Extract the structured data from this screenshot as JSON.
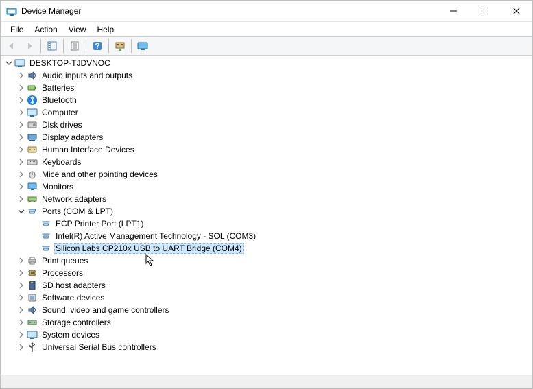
{
  "window": {
    "title": "Device Manager"
  },
  "menu": {
    "items": [
      "File",
      "Action",
      "View",
      "Help"
    ]
  },
  "tree": {
    "root": "DESKTOP-TJDVNOC",
    "nodes": {
      "audio": {
        "label": "Audio inputs and outputs"
      },
      "batt": {
        "label": "Batteries"
      },
      "bt": {
        "label": "Bluetooth"
      },
      "comp": {
        "label": "Computer"
      },
      "disk": {
        "label": "Disk drives"
      },
      "disp": {
        "label": "Display adapters"
      },
      "hid": {
        "label": "Human Interface Devices"
      },
      "kbd": {
        "label": "Keyboards"
      },
      "mouse": {
        "label": "Mice and other pointing devices"
      },
      "mon": {
        "label": "Monitors"
      },
      "net": {
        "label": "Network adapters"
      },
      "ports": {
        "label": "Ports (COM & LPT)"
      },
      "ports_c0": {
        "label": "ECP Printer Port (LPT1)"
      },
      "ports_c1": {
        "label": "Intel(R) Active Management Technology - SOL (COM3)"
      },
      "ports_c2": {
        "label": "Silicon Labs CP210x USB to UART Bridge (COM4)"
      },
      "printq": {
        "label": "Print queues"
      },
      "proc": {
        "label": "Processors"
      },
      "sdhost": {
        "label": "SD host adapters"
      },
      "softdev": {
        "label": "Software devices"
      },
      "sound": {
        "label": "Sound, video and game controllers"
      },
      "storctl": {
        "label": "Storage controllers"
      },
      "sysdev": {
        "label": "System devices"
      },
      "usb": {
        "label": "Universal Serial Bus controllers"
      }
    }
  }
}
